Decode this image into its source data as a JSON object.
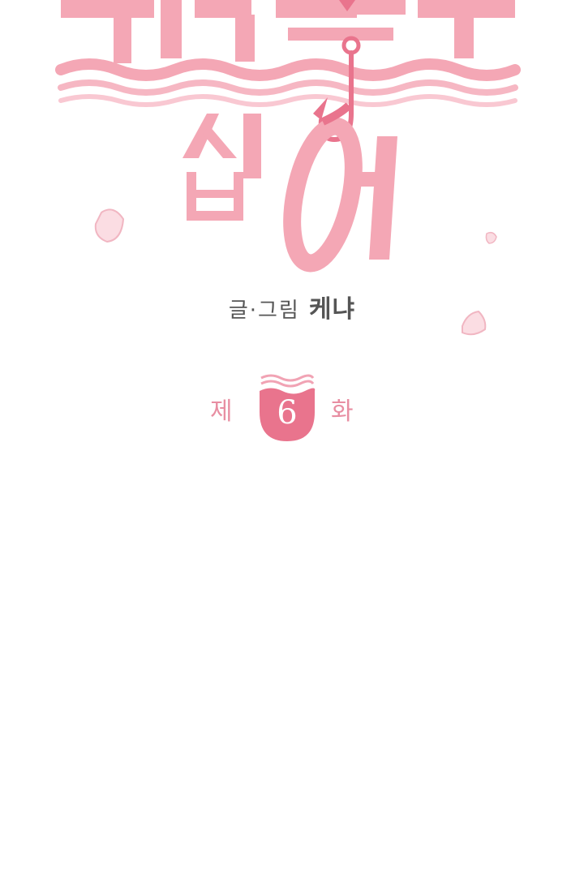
{
  "title": {
    "line1": "죽이고 싶어",
    "line2": "싶어"
  },
  "credit": {
    "role": "글·그림",
    "author": "케냐"
  },
  "episode": {
    "prefix": "제",
    "number": "6",
    "suffix": "화"
  },
  "colors": {
    "title_pink": "#f4a7b5",
    "title_light": "#f9c8d2",
    "accent": "#e9748d",
    "credit_gray": "#555555",
    "background": "#ffffff"
  },
  "icons": {
    "hook": "fishing-hook-icon",
    "waves": "wave-lines",
    "petals": "petal-shape"
  }
}
